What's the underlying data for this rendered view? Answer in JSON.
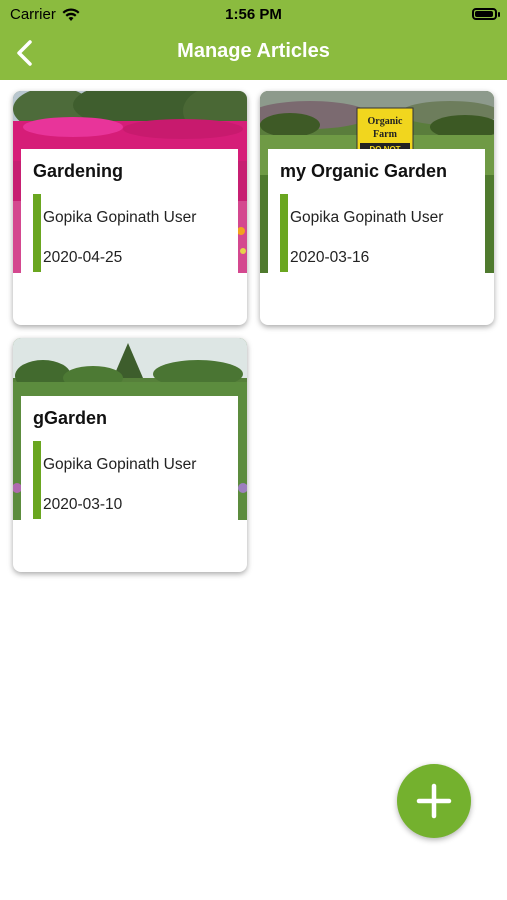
{
  "status_bar": {
    "carrier": "Carrier",
    "time": "1:56 PM"
  },
  "header": {
    "title": "Manage Articles"
  },
  "articles": [
    {
      "title": "Gardening",
      "author": "Gopika Gopinath User",
      "date": "2020-04-25"
    },
    {
      "title": "my Organic Garden",
      "author": "Gopika Gopinath User",
      "date": "2020-03-16"
    },
    {
      "title": "gGarden",
      "author": "Gopika Gopinath User",
      "date": "2020-03-10"
    }
  ],
  "sign": {
    "line1": "Organic",
    "line2": "Farm",
    "line3": "DO NOT"
  },
  "colors": {
    "header": "#8bbb3f",
    "accent": "#6aa620",
    "fab": "#74b12e"
  },
  "icons": {
    "back": "chevron-left-icon",
    "add": "plus-icon",
    "wifi": "wifi-icon",
    "battery": "battery-icon"
  }
}
